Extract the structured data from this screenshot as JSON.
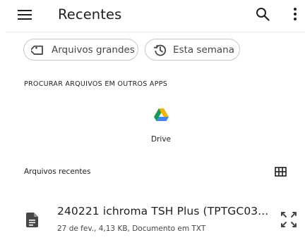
{
  "appbar": {
    "title": "Recentes",
    "menu_icon": "menu-icon",
    "search_icon": "search-icon",
    "more_icon": "more-vert-icon"
  },
  "chips": [
    {
      "label": "Arquivos grandes",
      "icon": "label-tag-icon"
    },
    {
      "label": "Esta semana",
      "icon": "history-icon"
    }
  ],
  "other_apps": {
    "header": "PROCURAR ARQUIVOS EM OUTROS APPS",
    "apps": [
      {
        "label": "Drive",
        "icon": "google-drive-icon"
      }
    ]
  },
  "recent": {
    "title": "Arquivos recentes",
    "view_toggle_icon": "grid-view-icon",
    "files": [
      {
        "name": "240221 ichroma TSH Plus (TPTGC03...",
        "meta": "27 de fev., 4,13 KB, Documento em TXT",
        "icon": "document-icon",
        "action_icon": "expand-icon"
      }
    ]
  },
  "colors": {
    "text": "#1f1f1f",
    "secondary": "#444746",
    "chip_border": "#c4c7c5",
    "drive_green": "#0f9d58",
    "drive_yellow": "#f4b400",
    "drive_blue": "#4285f4"
  }
}
